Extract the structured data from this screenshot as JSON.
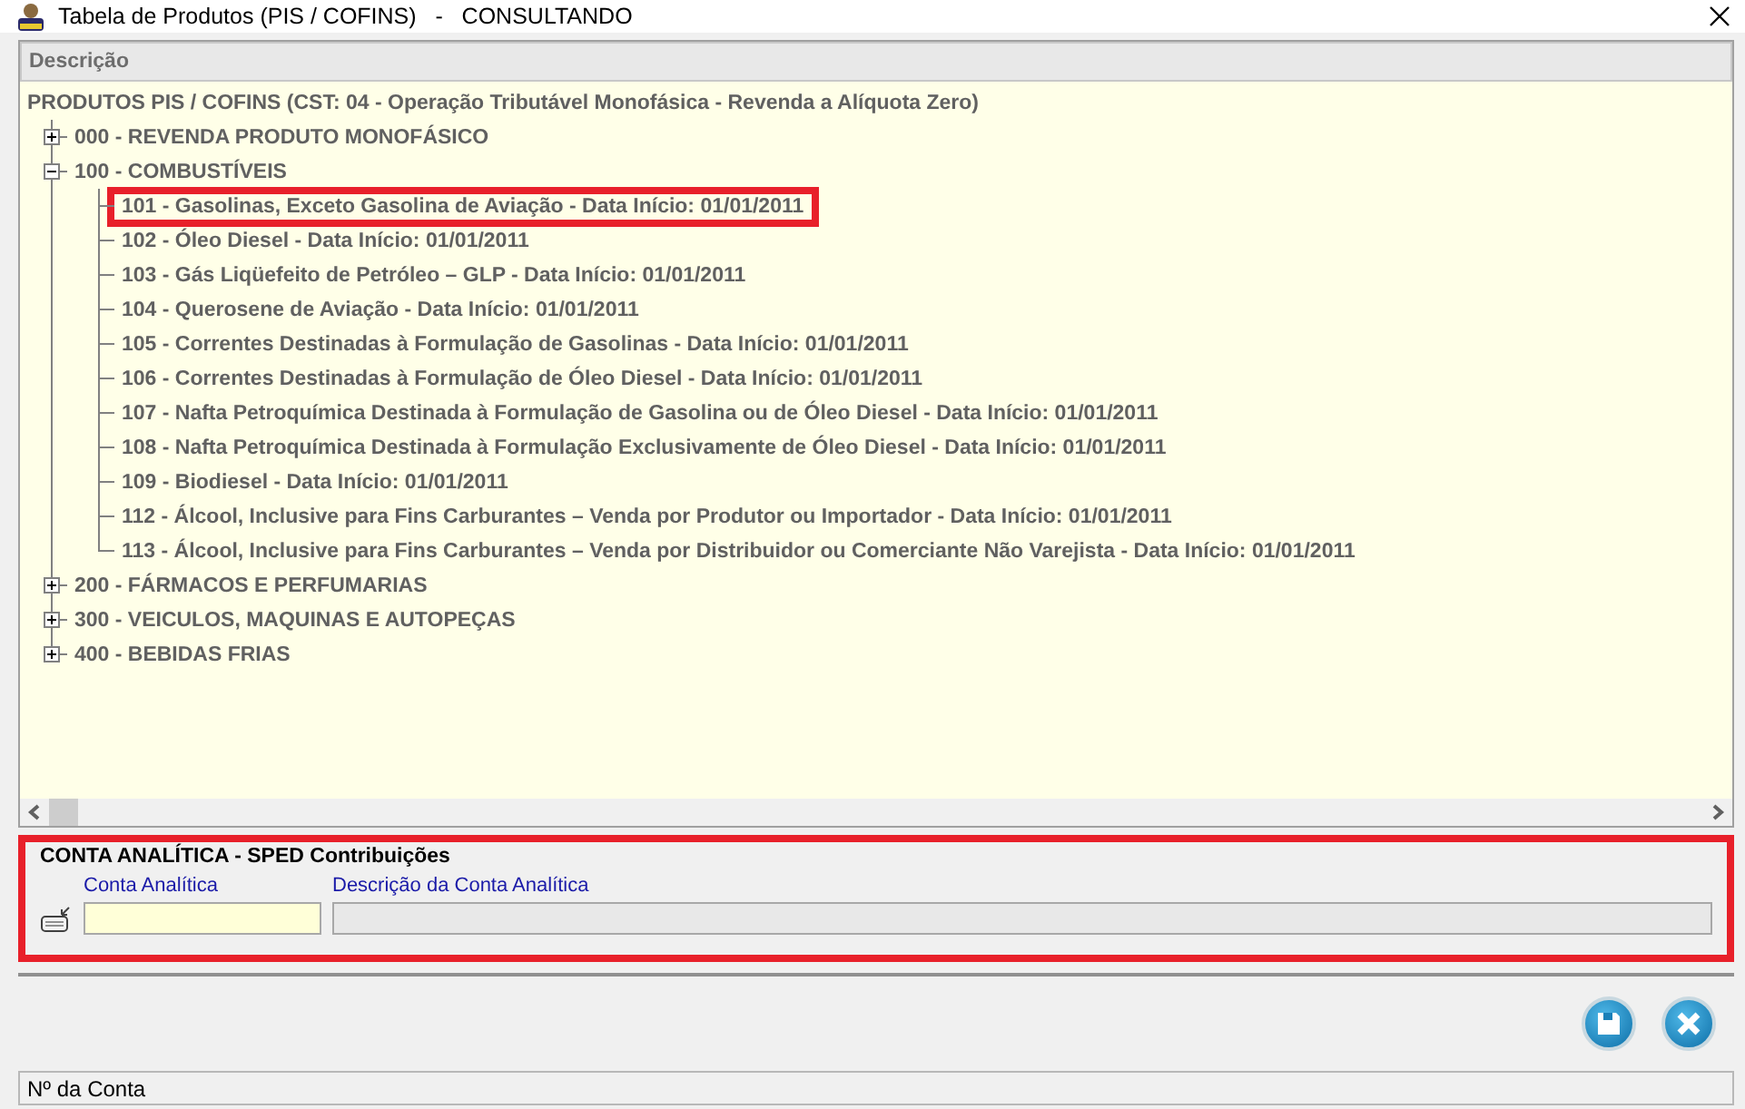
{
  "window": {
    "title": "Tabela de Produtos (PIS / COFINS)   -   CONSULTANDO"
  },
  "tree": {
    "column_header": "Descrição",
    "root": "PRODUTOS PIS / COFINS (CST: 04 - Operação Tributável Monofásica - Revenda a Alíquota Zero)",
    "groups": [
      {
        "label": "000 - REVENDA PRODUTO MONOFÁSICO",
        "expanded": false
      },
      {
        "label": "100 - COMBUSTÍVEIS",
        "expanded": true,
        "children": [
          {
            "label": "101 - Gasolinas, Exceto Gasolina de Aviação - Data Início: 01/01/2011",
            "highlighted": true
          },
          {
            "label": "102 - Óleo Diesel - Data Início: 01/01/2011",
            "highlighted": false
          },
          {
            "label": "103 - Gás Liqüefeito de Petróleo – GLP - Data Início: 01/01/2011",
            "highlighted": false
          },
          {
            "label": "104 - Querosene de Aviação - Data Início: 01/01/2011",
            "highlighted": false
          },
          {
            "label": "105 - Correntes Destinadas à Formulação de Gasolinas - Data Início: 01/01/2011",
            "highlighted": false
          },
          {
            "label": "106 - Correntes Destinadas à Formulação de Óleo Diesel - Data Início: 01/01/2011",
            "highlighted": false
          },
          {
            "label": "107 - Nafta Petroquímica Destinada à Formulação de Gasolina ou de Óleo Diesel - Data Início: 01/01/2011",
            "highlighted": false
          },
          {
            "label": "108 - Nafta Petroquímica Destinada à Formulação Exclusivamente de Óleo Diesel - Data Início: 01/01/2011",
            "highlighted": false
          },
          {
            "label": "109 - Biodiesel - Data Início: 01/01/2011",
            "highlighted": false
          },
          {
            "label": "112 - Álcool, Inclusive para Fins Carburantes – Venda por Produtor ou Importador - Data Início: 01/01/2011",
            "highlighted": false
          },
          {
            "label": "113 - Álcool, Inclusive para Fins Carburantes – Venda por Distribuidor ou Comerciante Não Varejista - Data Início: 01/01/2011",
            "highlighted": false
          }
        ]
      },
      {
        "label": "200 - FÁRMACOS E PERFUMARIAS",
        "expanded": false
      },
      {
        "label": "300 - VEICULOS, MAQUINAS E AUTOPEÇAS",
        "expanded": false
      },
      {
        "label": "400 - BEBIDAS FRIAS",
        "expanded": false
      }
    ]
  },
  "panel": {
    "title": "CONTA ANALÍTICA  - SPED Contribuições",
    "highlighted": true,
    "fields": [
      {
        "label": "Conta Analítica",
        "disabled": false
      },
      {
        "label": "Descrição da Conta Analítica",
        "disabled": true
      }
    ]
  },
  "status_bar": {
    "text": "Nº da Conta"
  }
}
